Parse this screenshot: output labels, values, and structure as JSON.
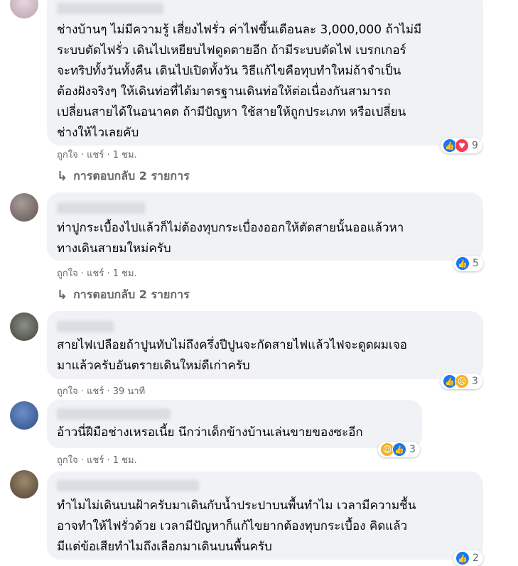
{
  "comments": [
    {
      "text": "ช่างบ้านๆ ไม่มีความรู้ เสี่ยงไฟรั่ว ค่าไฟขึ้นเดือนละ 3,000,000 ถ้าไม่มี\nระบบตัดไฟรั่ว เดินไปเหยียบไฟดูดตายอีก ถ้ามีระบบตัดไฟ เบรกเกอร์\nจะทริปทั้งวันทั้งคืน เดินไปเปิดทั้งวัน วิธีแก้ไขคือทุบทำใหม่ถ้าจำเป็น\nต้องฝังจริงๆ ให้เดินท่อที่ได้มาตรฐานเดินท่อให้ต่อเนื่องกันสามารถ\nเปลี่ยนสายได้ในอนาคต ถ้ามีปัญหา ใช้สายให้ถูกประเภท หรือเปลี่ยน\nช่างให้ไวเลยคับ",
      "like": "ถูกใจ",
      "reply": "แชร์",
      "time": "1 ชม.",
      "reaction_count": "9",
      "reactions": [
        "like-icon",
        "love-icon"
      ],
      "replies_label": "การตอบกลับ 2 รายการ"
    },
    {
      "text": "ท่าปูกระเบื้องไปแล้วก็ไม่ต้องทุบกระเบื่องออกให้ตัดสายนั้นออแล้วหา\nทางเดินสายมใหม่ครับ",
      "like": "ถูกใจ",
      "reply": "แชร์",
      "time": "1 ชม.",
      "reaction_count": "5",
      "reactions": [
        "like-icon"
      ],
      "replies_label": "การตอบกลับ 2 รายการ"
    },
    {
      "text": "สายไฟเปลือยถ้าปูนทับไม่ถึงครึ่งปีปูนจะกัดสายไฟแล้วไฟจะดูดผมเจอ\nมาแล้วครับอันตรายเดินใหม่ดีเก่าครับ",
      "like": "ถูกใจ",
      "reply": "แชร์",
      "time": "39 นาที",
      "reaction_count": "3",
      "reactions": [
        "like-icon",
        "sad-icon"
      ]
    },
    {
      "text": "อ้าวนี่ฝีมือช่างเหรอเนี้ย นึกว่าเด็กข้างบ้านเล่นขายของซะอีก",
      "like": "ถูกใจ",
      "reply": "แชร์",
      "time": "1 ชม.",
      "reaction_count": "3",
      "reactions": [
        "haha-icon",
        "like-icon"
      ]
    },
    {
      "text": "ทำไมไม่เดินบนฝ้าครับมาเดินกับน้ำประปาบนพื้นทำไม เวลามีความชื้น\nอาจทำให้ไฟรั่วด้วย เวลามีปัญหาก็แก้ไขยากต้องทุบกระเบื้อง คิดแล้ว\nมีแต่ข้อเสียทำไมถึงเลือกมาเดินบนพื้นครับ",
      "reaction_count": "2",
      "reactions": [
        "like-icon"
      ]
    }
  ],
  "colors": {
    "bubble": "#f0f2f5",
    "secondary_text": "#65676b",
    "like": "#1877f2",
    "love": "#f33e58",
    "emoji": "#f7b125"
  }
}
